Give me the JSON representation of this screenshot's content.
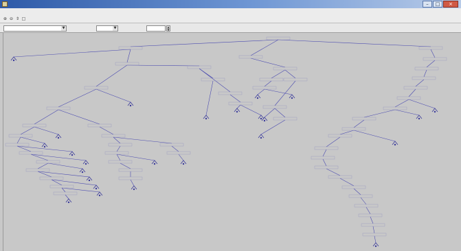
{
  "tree": {
    "nodes": [
      {
        "id": "root"
      },
      {
        "id": "L1a",
        "parent": "root"
      },
      {
        "id": "L1b",
        "parent": "root"
      },
      {
        "id": "L1c",
        "parent": "root"
      },
      {
        "id": "a1",
        "parent": "L1a"
      },
      {
        "id": "a2",
        "parent": "L1a"
      },
      {
        "id": "a2a",
        "parent": "a2"
      },
      {
        "id": "a2b",
        "parent": "a2"
      },
      {
        "id": "a3",
        "parent": "a2a"
      },
      {
        "id": "a3b",
        "parent": "a2a"
      },
      {
        "id": "a4",
        "parent": "a3"
      },
      {
        "id": "a4b",
        "parent": "a3"
      },
      {
        "id": "a5",
        "parent": "a4"
      },
      {
        "id": "a5b",
        "parent": "a4"
      },
      {
        "id": "a6",
        "parent": "a5"
      },
      {
        "id": "a6b",
        "parent": "a5"
      },
      {
        "id": "a7",
        "parent": "a6"
      },
      {
        "id": "a7b",
        "parent": "a6"
      },
      {
        "id": "a8",
        "parent": "a7"
      },
      {
        "id": "a8b",
        "parent": "a7"
      },
      {
        "id": "a9",
        "parent": "a8"
      },
      {
        "id": "a9b",
        "parent": "a8"
      },
      {
        "id": "a10",
        "parent": "a9"
      },
      {
        "id": "a10b",
        "parent": "a9"
      },
      {
        "id": "a11",
        "parent": "a10"
      },
      {
        "id": "a11b",
        "parent": "a10"
      },
      {
        "id": "a12",
        "parent": "a11"
      },
      {
        "id": "a12b",
        "parent": "a11"
      },
      {
        "id": "a13",
        "parent": "a12"
      },
      {
        "id": "a5c",
        "parent": "a4b"
      },
      {
        "id": "a6c",
        "parent": "a5c"
      },
      {
        "id": "a6d",
        "parent": "a5c"
      },
      {
        "id": "a7c",
        "parent": "a6c"
      },
      {
        "id": "a8c",
        "parent": "a7c"
      },
      {
        "id": "a8d",
        "parent": "a7c"
      },
      {
        "id": "a9c",
        "parent": "a8c"
      },
      {
        "id": "a10c",
        "parent": "a9c"
      },
      {
        "id": "a11c",
        "parent": "a10c"
      },
      {
        "id": "a7d",
        "parent": "a6d"
      },
      {
        "id": "a8e",
        "parent": "a7d"
      },
      {
        "id": "b1",
        "parent": "a2b"
      },
      {
        "id": "b2",
        "parent": "a2b"
      },
      {
        "id": "b3",
        "parent": "b1"
      },
      {
        "id": "b4",
        "parent": "b2"
      },
      {
        "id": "b5",
        "parent": "b4"
      },
      {
        "id": "b6",
        "parent": "b4"
      },
      {
        "id": "c1",
        "parent": "L1b"
      },
      {
        "id": "c2",
        "parent": "c1"
      },
      {
        "id": "c3",
        "parent": "c1"
      },
      {
        "id": "c4",
        "parent": "c2"
      },
      {
        "id": "c5",
        "parent": "c4"
      },
      {
        "id": "c6",
        "parent": "c4"
      },
      {
        "id": "c7",
        "parent": "c3"
      },
      {
        "id": "c8",
        "parent": "c7"
      },
      {
        "id": "c9",
        "parent": "c7"
      },
      {
        "id": "c10",
        "parent": "c9"
      },
      {
        "id": "d1",
        "parent": "L1c"
      },
      {
        "id": "d2",
        "parent": "d1"
      },
      {
        "id": "d3",
        "parent": "d2"
      },
      {
        "id": "d4",
        "parent": "d3"
      },
      {
        "id": "d5",
        "parent": "d4"
      },
      {
        "id": "d6",
        "parent": "d5"
      },
      {
        "id": "d7",
        "parent": "d5"
      },
      {
        "id": "d8",
        "parent": "d6"
      },
      {
        "id": "d9",
        "parent": "d6"
      },
      {
        "id": "d10",
        "parent": "d8"
      },
      {
        "id": "d11",
        "parent": "d10"
      },
      {
        "id": "d12",
        "parent": "d10"
      },
      {
        "id": "d13",
        "parent": "d11"
      },
      {
        "id": "d14",
        "parent": "d13"
      },
      {
        "id": "d15",
        "parent": "d14"
      },
      {
        "id": "d16",
        "parent": "d15"
      },
      {
        "id": "d17",
        "parent": "d16"
      },
      {
        "id": "d18",
        "parent": "d17"
      },
      {
        "id": "d19",
        "parent": "d18"
      },
      {
        "id": "d20",
        "parent": "d19"
      },
      {
        "id": "d21",
        "parent": "d20"
      },
      {
        "id": "d22",
        "parent": "d21"
      },
      {
        "id": "d23",
        "parent": "d22"
      }
    ]
  },
  "colors": {
    "edge": "#4a4ab0",
    "leaf": "#3a3a9a",
    "canvas": "#c8c8c8"
  }
}
